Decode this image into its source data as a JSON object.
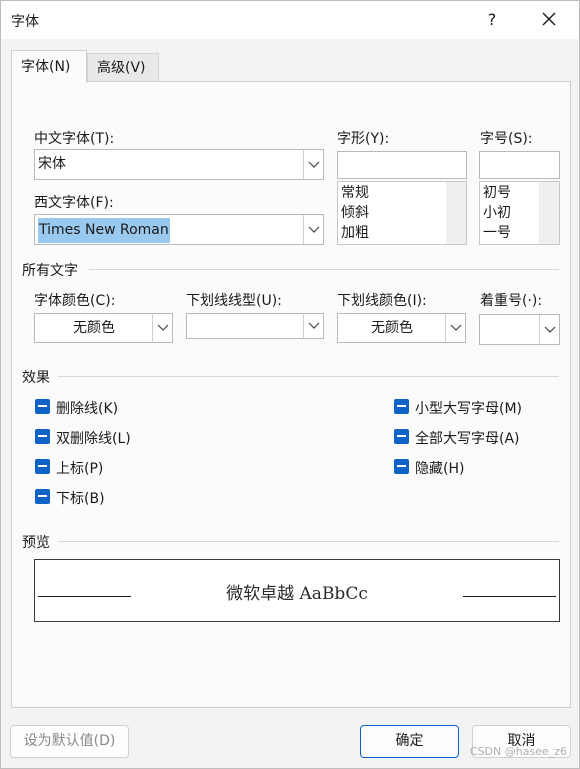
{
  "window": {
    "title": "字体",
    "help": "?"
  },
  "tabs": [
    {
      "label": "字体(N)"
    },
    {
      "label": "高级(V)"
    }
  ],
  "font": {
    "chinese_label": "中文字体(T):",
    "chinese_value": "宋体",
    "western_label": "西文字体(F):",
    "western_value": "Times New Roman",
    "style_label": "字形(Y):",
    "style_value": "",
    "style_options": [
      "常规",
      "倾斜",
      "加粗"
    ],
    "size_label": "字号(S):",
    "size_value": "",
    "size_options": [
      "初号",
      "小初",
      "一号"
    ]
  },
  "all_text": {
    "section": "所有文字",
    "font_color_label": "字体颜色(C):",
    "font_color_value": "无颜色",
    "underline_style_label": "下划线线型(U):",
    "underline_style_value": "",
    "underline_color_label": "下划线颜色(I):",
    "underline_color_value": "无颜色",
    "emphasis_label": "着重号(·):",
    "emphasis_value": ""
  },
  "effects": {
    "section": "效果",
    "items": [
      {
        "label": "删除线(K)",
        "state": "indeterminate"
      },
      {
        "label": "双删除线(L)",
        "state": "indeterminate"
      },
      {
        "label": "上标(P)",
        "state": "indeterminate"
      },
      {
        "label": "下标(B)",
        "state": "indeterminate"
      },
      {
        "label": "小型大写字母(M)",
        "state": "indeterminate"
      },
      {
        "label": "全部大写字母(A)",
        "state": "indeterminate"
      },
      {
        "label": "隐藏(H)",
        "state": "indeterminate"
      }
    ]
  },
  "preview": {
    "section": "预览",
    "sample": "微软卓越  AaBbCc"
  },
  "buttons": {
    "set_default": "设为默认值(D)",
    "ok": "确定",
    "cancel": "取消"
  },
  "watermark": "CSDN @hasee_z6",
  "colors": {
    "accent": "#0f62c6",
    "selection": "#99c9ef"
  }
}
